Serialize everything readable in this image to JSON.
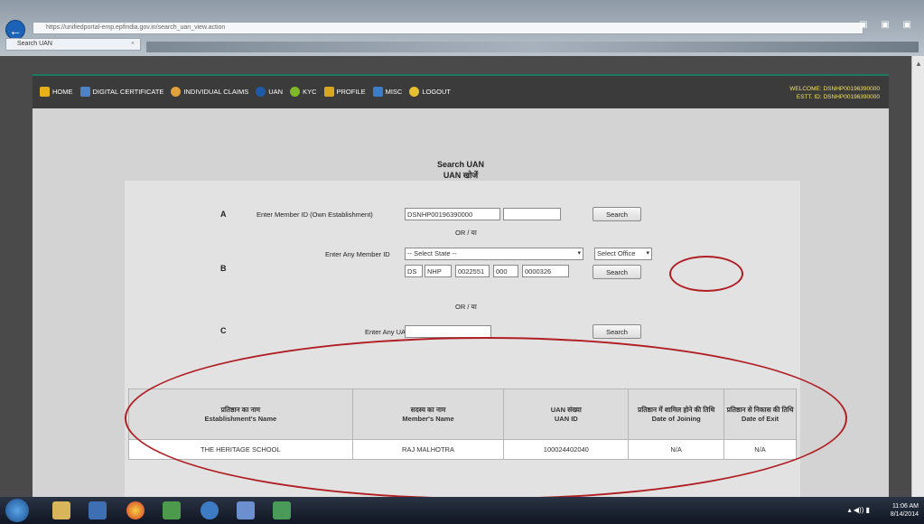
{
  "browser": {
    "tab_title": "Search UAN",
    "address": "https://unifiedportal-emp.epfindia.gov.in/search_uan_view.action",
    "tab_close": "×",
    "back": "←"
  },
  "nav": {
    "items": [
      {
        "label": "HOME",
        "icon": "home-icon"
      },
      {
        "label": "DIGITAL CERTIFICATE",
        "icon": "certificate-icon"
      },
      {
        "label": "INDIVIDUAL CLAIMS",
        "icon": "claims-icon"
      },
      {
        "label": "UAN",
        "icon": "uan-icon"
      },
      {
        "label": "KYC",
        "icon": "kyc-icon"
      },
      {
        "label": "PROFILE",
        "icon": "profile-icon"
      },
      {
        "label": "MISC",
        "icon": "misc-icon"
      },
      {
        "label": "LOGOUT",
        "icon": "logout-icon"
      }
    ],
    "welcome": "WELCOME: DSNHP00196390000",
    "estt": "ESTT. ID: DSNHP00196390000"
  },
  "page": {
    "title_en": "Search UAN",
    "title_hi": "UAN खोजें"
  },
  "form": {
    "section_a": {
      "letter": "A",
      "label": "Enter Member ID (Own Establishment)",
      "prefix_value": "DSNHP00196390000",
      "member_value": "",
      "search_label": "Search"
    },
    "or_label": "OR / या",
    "section_b": {
      "letter": "B",
      "label": "Enter Any Member ID",
      "state_select": "-- Select State --",
      "office_select": "Select Office",
      "parts": [
        "DS",
        "NHP",
        "0022551",
        "000",
        "0000326"
      ],
      "search_label": "Search"
    },
    "section_c": {
      "letter": "C",
      "label": "Enter Any UAN",
      "uan_value": "",
      "search_label": "Search"
    }
  },
  "results": {
    "headers": [
      {
        "hi": "प्रतिष्ठान का नाम",
        "en": "Establishment's Name"
      },
      {
        "hi": "सदस्य का नाम",
        "en": "Member's Name"
      },
      {
        "hi": "UAN संख्या",
        "en": "UAN ID"
      },
      {
        "hi": "प्रतिष्ठान में शामिल होने की तिथि",
        "en": "Date of Joining"
      },
      {
        "hi": "प्रतिष्ठान से निकास की तिथि",
        "en": "Date of Exit"
      }
    ],
    "rows": [
      [
        "THE HERITAGE SCHOOL",
        "RAJ MALHOTRA",
        "100024402040",
        "N/A",
        "N/A"
      ]
    ]
  },
  "taskbar": {
    "time": "11:06 AM",
    "date": "8/14/2014"
  },
  "colors": {
    "nav_bg": "#3b3b3b",
    "annotation": "#b01e23",
    "content_bg": "#d3d3d3"
  }
}
